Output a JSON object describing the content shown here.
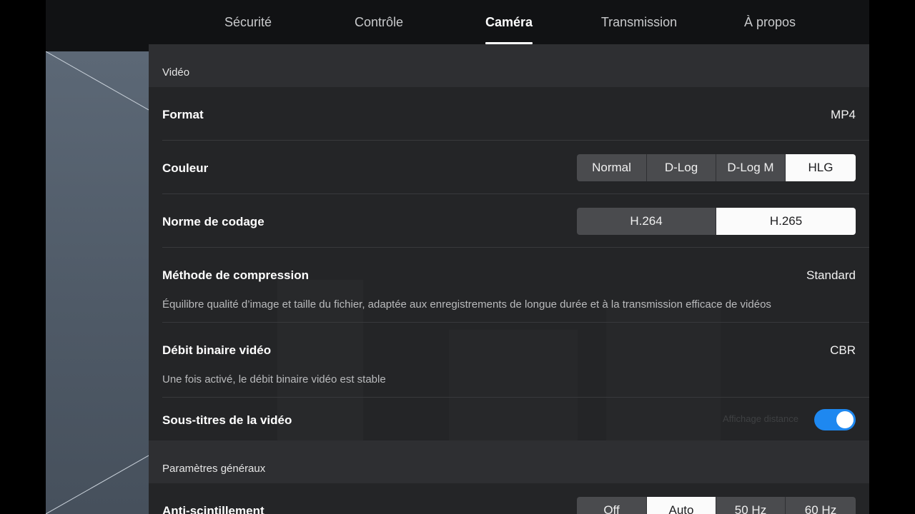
{
  "tabs": [
    {
      "label": "Sécurité",
      "active": false
    },
    {
      "label": "Contrôle",
      "active": false
    },
    {
      "label": "Caméra",
      "active": true
    },
    {
      "label": "Transmission",
      "active": false
    },
    {
      "label": "À propos",
      "active": false
    }
  ],
  "sections": {
    "video": {
      "title": "Vidéo",
      "format": {
        "label": "Format",
        "value": "MP4"
      },
      "couleur": {
        "label": "Couleur",
        "options": [
          "Normal",
          "D-Log",
          "D-Log M",
          "HLG"
        ],
        "selected": "HLG"
      },
      "codage": {
        "label": "Norme de codage",
        "options": [
          "H.264",
          "H.265"
        ],
        "selected": "H.265"
      },
      "compression": {
        "label": "Méthode de compression",
        "value": "Standard",
        "description": "Équilibre qualité d’image et taille du fichier, adaptée aux enregistrements de longue durée et à la transmission efficace de vidéos"
      },
      "debit": {
        "label": "Débit binaire vidéo",
        "value": "CBR",
        "description": "Une fois activé, le débit binaire vidéo est stable"
      },
      "soustitres": {
        "label": "Sous-titres de la vidéo",
        "enabled": true,
        "hint": "Affichage distance"
      }
    },
    "general": {
      "title": "Paramètres généraux",
      "antiflicker": {
        "label": "Anti-scintillement",
        "options": [
          "Off",
          "Auto",
          "50 Hz",
          "60 Hz"
        ],
        "selected": "Auto"
      }
    }
  },
  "colors": {
    "accent": "#1e88f0",
    "selected_segment": "#fbfbfb",
    "panel": "#242527"
  }
}
